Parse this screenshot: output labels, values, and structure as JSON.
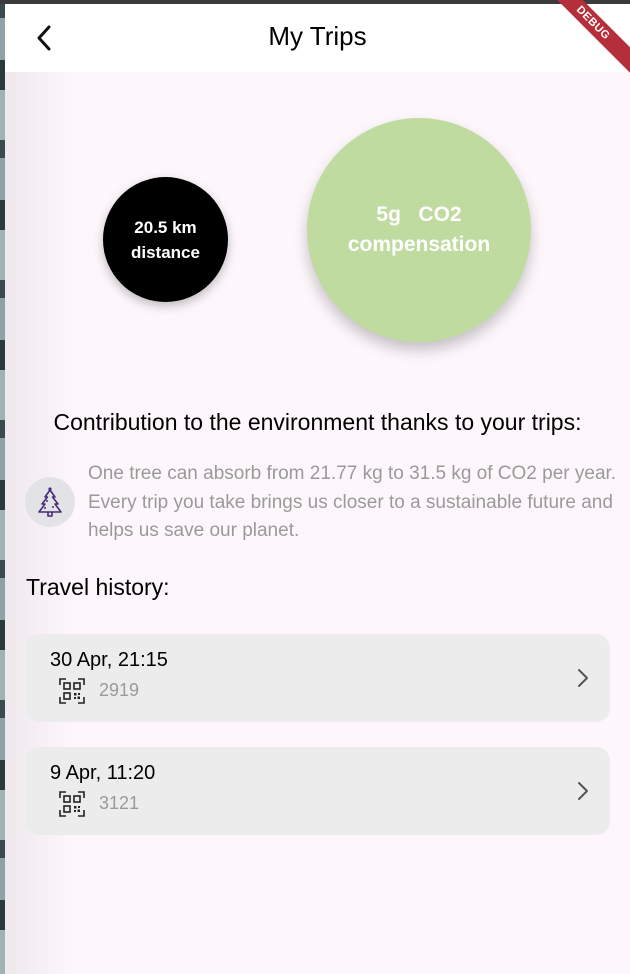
{
  "app_bar": {
    "title": "My Trips",
    "back_icon": "chevron-left-icon",
    "debug_label": "DEBUG"
  },
  "stats": {
    "distance_value": "20.5 km",
    "distance_label": "distance",
    "co2_value": "5g",
    "co2_unit": "CO2",
    "co2_label": "compensation"
  },
  "environment": {
    "title": "Contribution to the environment thanks to your trips:",
    "icon": "christmas-tree-icon",
    "text": "One tree can absorb from 21.77 kg to 31.5 kg of CO2 per year. Every trip you take brings us closer to a sustainable future and helps us save our planet."
  },
  "history": {
    "title": "Travel history:",
    "trips": [
      {
        "date": "30 Apr, 21:15",
        "code": "2919",
        "icon": "qr-code-icon"
      },
      {
        "date": "9 Apr, 11:20",
        "code": "3121",
        "icon": "qr-code-icon"
      }
    ]
  },
  "colors": {
    "background": "#fdf7fb",
    "distance_circle": "#000000",
    "co2_circle": "#c0dba0",
    "card": "#ececec",
    "muted_text": "#9a9a9a",
    "debug_ribbon": "#b52f3a"
  }
}
